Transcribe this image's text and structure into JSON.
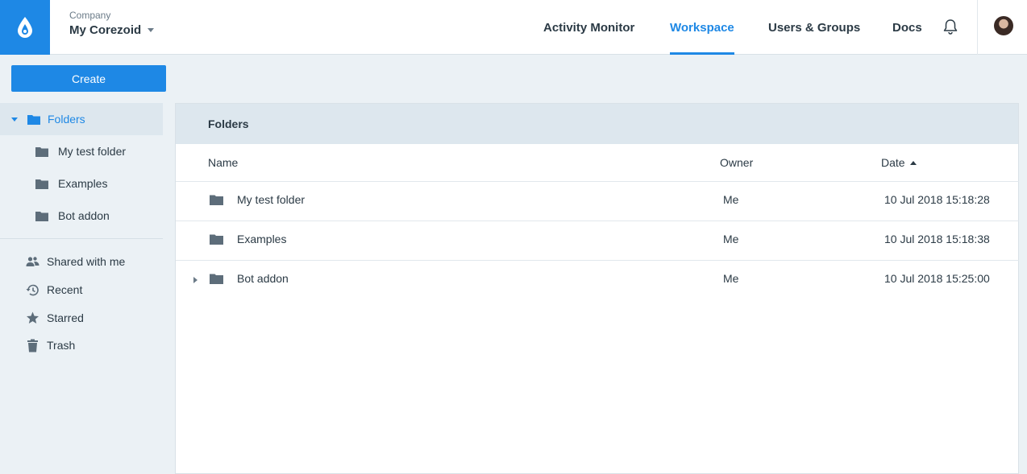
{
  "header": {
    "company_label": "Company",
    "company_name": "My Corezoid",
    "nav": {
      "activity_monitor": "Activity Monitor",
      "workspace": "Workspace",
      "users_groups": "Users & Groups",
      "docs": "Docs"
    },
    "active_nav": "Workspace"
  },
  "sidebar": {
    "create_label": "Create",
    "tree_root": "Folders",
    "folders": [
      "My test folder",
      "Examples",
      "Bot addon"
    ],
    "links": [
      "Shared with me",
      "Recent",
      "Starred",
      "Trash"
    ]
  },
  "main": {
    "title": "Folders",
    "columns": {
      "name": "Name",
      "owner": "Owner",
      "date": "Date"
    },
    "sort": {
      "column": "Date",
      "direction": "ascending"
    },
    "rows": [
      {
        "name": "My test folder",
        "owner": "Me",
        "date": "10 Jul 2018 15:18:28"
      },
      {
        "name": "Examples",
        "owner": "Me",
        "date": "10 Jul 2018 15:18:38"
      },
      {
        "name": "Bot addon",
        "owner": "Me",
        "date": "10 Jul 2018 15:25:00"
      }
    ]
  },
  "colors": {
    "accent": "#1e88e5",
    "background": "#ebf1f5",
    "panel_header": "#dde7ee",
    "text": "#2b3a45",
    "icon": "#5d6d7a"
  },
  "icons": {
    "logo": "drop-logo-icon",
    "notifications": "bell-icon",
    "folder": "folder-icon",
    "shared": "users-icon",
    "recent": "history-icon",
    "starred": "star-icon",
    "trash": "trash-icon"
  }
}
